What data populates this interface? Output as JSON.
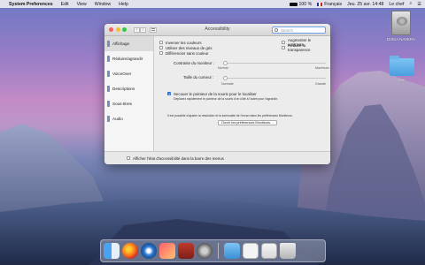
{
  "menubar": {
    "apple": "",
    "app_name": "System Preferences",
    "menus": [
      "Edit",
      "View",
      "Window",
      "Help"
    ],
    "battery": "100 %",
    "input_source": "Français",
    "clock": "Jeu. 25 avr. 14:48",
    "user": "Le chef"
  },
  "desktop": {
    "disk_label": "DISKA NAVERA",
    "folder_label": "titre"
  },
  "window": {
    "title": "Accessibility",
    "search_placeholder": "Search",
    "sidebar": [
      "Affichage",
      "Réduire/agrandir",
      "VoiceOver",
      "Descriptions",
      "Sous-titres",
      "Audio"
    ],
    "options_left": [
      "Inverser les couleurs",
      "Utiliser des niveaux de gris",
      "Différencier sans couleur"
    ],
    "options_right": [
      "Augmenter le contraste",
      "Réduire la transparence"
    ],
    "contrast_label": "Contraste du moniteur :",
    "contrast_min": "Normal",
    "contrast_max": "Maximum",
    "cursor_label": "Taille du curseur :",
    "cursor_min": "Normale",
    "cursor_max": "Grande",
    "shake_label": "Secouer le pointeur de la souris pour le localiser",
    "shake_desc": "Déplacez rapidement le pointeur de la souris d'un côté à l'autre pour l'agrandir.",
    "note": "Il est possible d'ajuster la résolution et la luminosité de l'écran dans les préférences Moniteurs.",
    "monitors_button": "Ouvrir les préférences Moniteurs…",
    "footer_label": "Afficher l'état d'accessibilité dans la barre des menus",
    "shake_checked": true,
    "footer_checked": false,
    "contrast_level": 0.0,
    "cursor_level": 0.0
  },
  "dock_apps": [
    "finder-icon",
    "firefox-icon",
    "thunderbird-icon",
    "music-icon",
    "photo-booth-icon",
    "system-preferences-icon",
    "folder-icon",
    "document-icon",
    "mail-icon",
    "trash-icon"
  ]
}
